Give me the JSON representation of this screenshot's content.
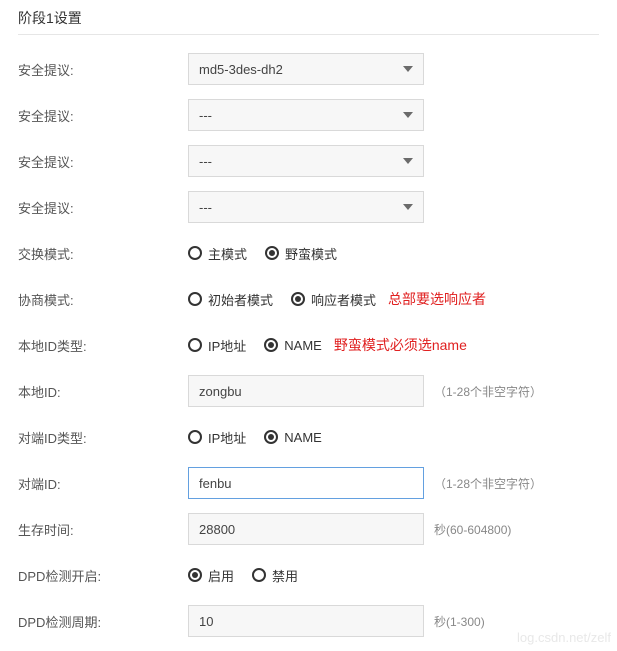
{
  "section_title": "阶段1设置",
  "rows": {
    "proposal1": {
      "label": "安全提议:",
      "value": "md5-3des-dh2"
    },
    "proposal2": {
      "label": "安全提议:",
      "value": "---"
    },
    "proposal3": {
      "label": "安全提议:",
      "value": "---"
    },
    "proposal4": {
      "label": "安全提议:",
      "value": "---"
    },
    "exchange_mode": {
      "label": "交换模式:",
      "options": {
        "main": "主模式",
        "aggressive": "野蛮模式"
      }
    },
    "negotiation_mode": {
      "label": "协商模式:",
      "options": {
        "initiator": "初始者模式",
        "responder": "响应者模式"
      },
      "note": "总部要选响应者"
    },
    "local_id_type": {
      "label": "本地ID类型:",
      "options": {
        "ip": "IP地址",
        "name": "NAME"
      },
      "note": "野蛮模式必须选name"
    },
    "local_id": {
      "label": "本地ID:",
      "value": "zongbu",
      "hint": "（1-28个非空字符）"
    },
    "peer_id_type": {
      "label": "对端ID类型:",
      "options": {
        "ip": "IP地址",
        "name": "NAME"
      }
    },
    "peer_id": {
      "label": "对端ID:",
      "value": "fenbu",
      "hint": "（1-28个非空字符）"
    },
    "lifetime": {
      "label": "生存时间:",
      "value": "28800",
      "hint": "秒(60-604800)"
    },
    "dpd_enable": {
      "label": "DPD检测开启:",
      "options": {
        "on": "启用",
        "off": "禁用"
      }
    },
    "dpd_period": {
      "label": "DPD检测周期:",
      "value": "10",
      "hint": "秒(1-300)"
    }
  },
  "watermark": "log.csdn.net/zelf"
}
